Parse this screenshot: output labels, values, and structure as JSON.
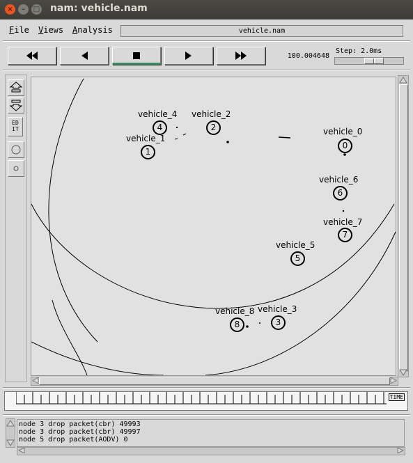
{
  "window": {
    "title": "nam: vehicle.nam"
  },
  "menu": {
    "file": "File",
    "views": "Views",
    "analysis": "Analysis"
  },
  "file_name": "vehicle.nam",
  "controls": {
    "rewind": "fast-rewind-icon",
    "back": "play-backward-icon",
    "stop": "stop-icon",
    "play": "play-forward-icon",
    "fastforward": "fast-forward-icon"
  },
  "time_readout": "100.004648",
  "step": {
    "label": "Step: 2.0ms"
  },
  "tools": [
    "zoom-in-icon",
    "zoom-out-icon",
    "edit-icon",
    "circle-large-icon",
    "circle-small-icon"
  ],
  "tool_edit_label": "ED IT",
  "nodes": [
    {
      "id": "0",
      "label": "vehicle_0"
    },
    {
      "id": "1",
      "label": "vehicle_1"
    },
    {
      "id": "2",
      "label": "vehicle_2"
    },
    {
      "id": "3",
      "label": "vehicle_3"
    },
    {
      "id": "4",
      "label": "vehicle_4"
    },
    {
      "id": "5",
      "label": "vehicle_5"
    },
    {
      "id": "6",
      "label": "vehicle_6"
    },
    {
      "id": "7",
      "label": "vehicle_7"
    },
    {
      "id": "8",
      "label": "vehicle_8"
    }
  ],
  "timeline": {
    "label": "TIME"
  },
  "log": [
    "node 3 drop packet(cbr) 49993",
    "node 3 drop packet(cbr) 49997",
    "node 5 drop packet(AODV) 0"
  ]
}
